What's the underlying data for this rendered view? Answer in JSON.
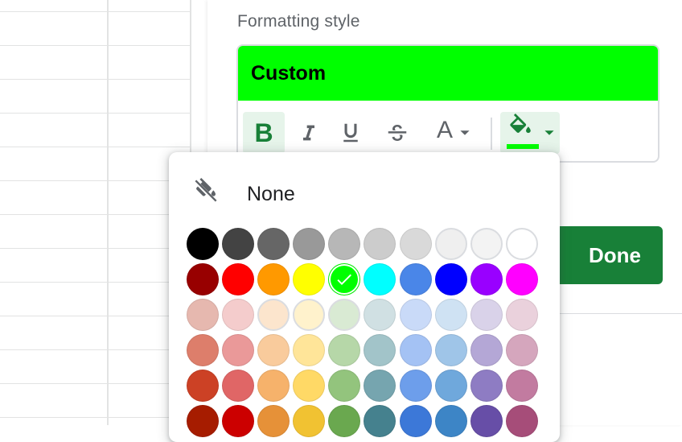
{
  "panel": {
    "formatting_style_label": "Formatting style",
    "preview_label": "Custom",
    "preview_bg": "#00ff00",
    "done_label": "Done",
    "accent": "#188038"
  },
  "toolbar": {
    "bold_glyph": "B",
    "italic_glyph": "I",
    "underline_glyph": "U",
    "strike_glyph": "S",
    "textcolor_glyph": "A",
    "fill_current": "#00ff00",
    "icons": [
      "bold-icon",
      "italic-icon",
      "underline-icon",
      "strikethrough-icon",
      "text-color-icon",
      "fill-color-icon"
    ]
  },
  "palette": {
    "none_label": "None",
    "selected": "#00ff00",
    "rows": [
      [
        "#000000",
        "#434343",
        "#666666",
        "#999999",
        "#b7b7b7",
        "#cccccc",
        "#d9d9d9",
        "#efefef",
        "#f3f3f3",
        "#ffffff"
      ],
      [
        "#980000",
        "#ff0000",
        "#ff9900",
        "#ffff00",
        "#00ff00",
        "#00ffff",
        "#4a86e8",
        "#0000ff",
        "#9900ff",
        "#ff00ff"
      ],
      [
        "#e6b8af",
        "#f4cccc",
        "#fce5cd",
        "#fff2cc",
        "#d9ead3",
        "#d0e0e3",
        "#c9daf8",
        "#cfe2f3",
        "#d9d2e9",
        "#ead1dc"
      ],
      [
        "#dd7e6b",
        "#ea9999",
        "#f9cb9c",
        "#ffe599",
        "#b6d7a8",
        "#a2c4c9",
        "#a4c2f4",
        "#9fc5e8",
        "#b4a7d6",
        "#d5a6bd"
      ],
      [
        "#cc4125",
        "#e06666",
        "#f6b26b",
        "#ffd966",
        "#93c47d",
        "#76a5af",
        "#6d9eeb",
        "#6fa8dc",
        "#8e7cc3",
        "#c27ba0"
      ],
      [
        "#a61c00",
        "#cc0000",
        "#e69138",
        "#f1c232",
        "#6aa84f",
        "#45818e",
        "#3c78d8",
        "#3d85c6",
        "#674ea7",
        "#a64d79"
      ]
    ]
  }
}
